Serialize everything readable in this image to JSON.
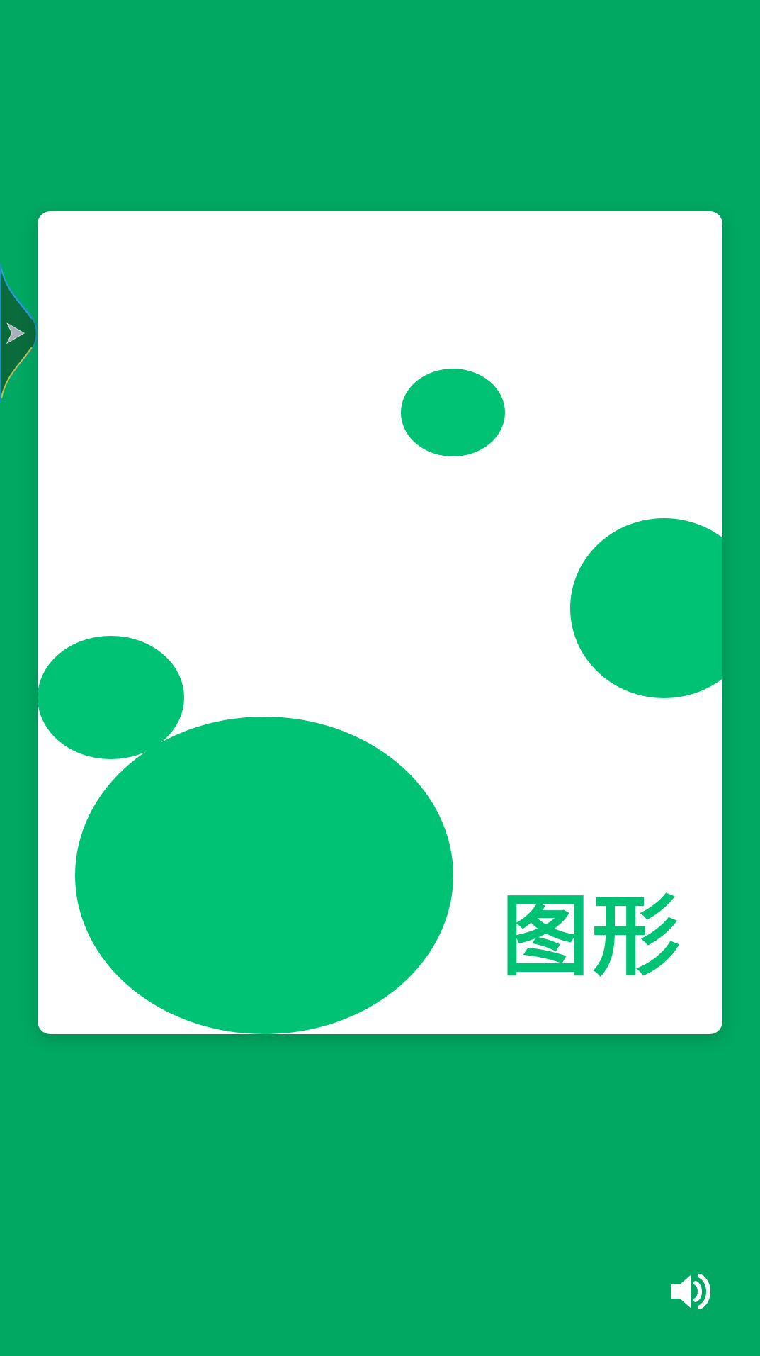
{
  "card": {
    "title": "图形"
  },
  "colors": {
    "background": "#00a862",
    "card": "#ffffff",
    "accent": "#00c274"
  },
  "icons": {
    "side_tab": "chevron-right-icon",
    "sound": "speaker-icon"
  }
}
